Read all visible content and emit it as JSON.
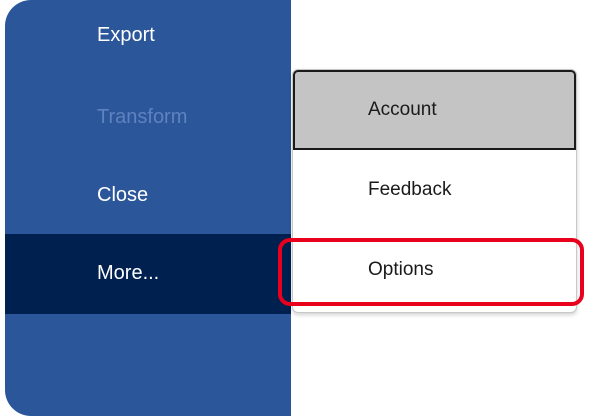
{
  "backstage": {
    "items": [
      {
        "label": "Export",
        "state": "normal"
      },
      {
        "label": "Transform",
        "state": "disabled"
      },
      {
        "label": "Close",
        "state": "normal"
      },
      {
        "label": "More...",
        "state": "selected"
      }
    ]
  },
  "more_menu": {
    "items": [
      {
        "label": "Account",
        "state": "focused"
      },
      {
        "label": "Feedback",
        "state": "normal"
      },
      {
        "label": "Options",
        "state": "highlighted"
      }
    ]
  },
  "colors": {
    "backstage_bg": "#2b579a",
    "selected_bg": "#002050",
    "highlight": "#e8001c"
  }
}
